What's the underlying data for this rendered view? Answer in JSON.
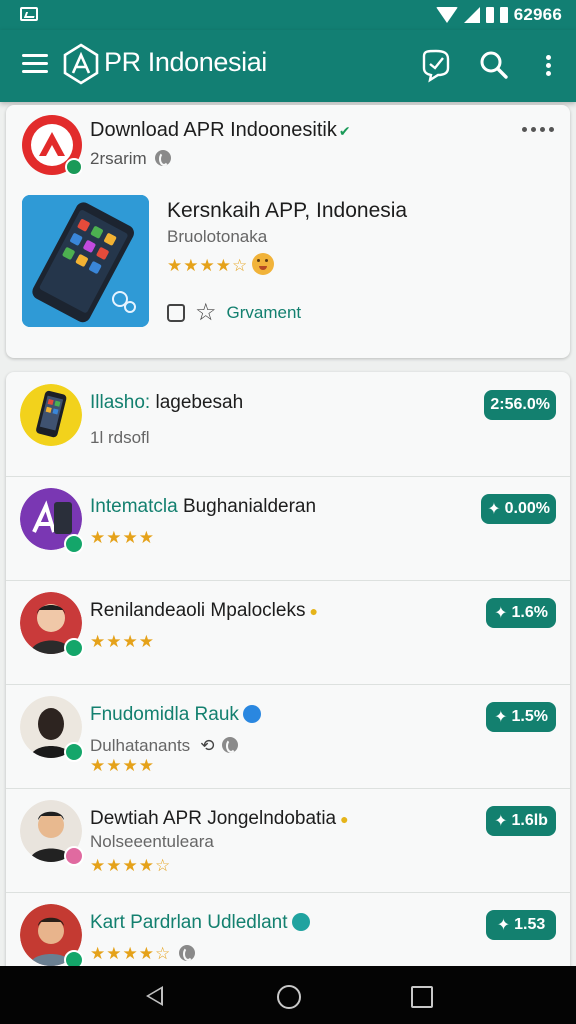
{
  "status": {
    "time": "62966"
  },
  "app": {
    "title": "PR Indonesiai"
  },
  "featured": {
    "title": "Download APR Indoonesitik",
    "subtitle": "2rsarim",
    "app_name": "Kersnkaih APP, Indonesia",
    "developer": "Bruolotonaka",
    "rating_display": "★★★★☆",
    "comment_label": "Grvament"
  },
  "rows": [
    {
      "title_accent": "Illasho:",
      "title_rest": "lagebesah",
      "subtitle": "1l rdsofl",
      "badge": "2:56.0%"
    },
    {
      "title_accent": "Intematcla",
      "title_rest": "Bughanialderan",
      "stars": "★★★★",
      "badge": "0.00%"
    },
    {
      "title_accent": "",
      "title_rest": "Renilandeaoli Mpalocleks",
      "stars": "★★★★",
      "badge": "1.6%"
    },
    {
      "title_accent": "Fnudomidla Rauk",
      "title_rest": "",
      "subtitle": "Dulhatanants",
      "stars": "★★★★",
      "badge": "1.5%"
    },
    {
      "title_accent": "",
      "title_rest": "Dewtiah APR Jongelndobatia",
      "subtitle": "Nolseeentuleara",
      "stars": "★★★★☆",
      "badge": "1.6lb"
    },
    {
      "title_accent": "Kart Pardrlan Udledlant",
      "title_rest": "",
      "stars": "★★★★☆",
      "badge": "1.53"
    }
  ]
}
